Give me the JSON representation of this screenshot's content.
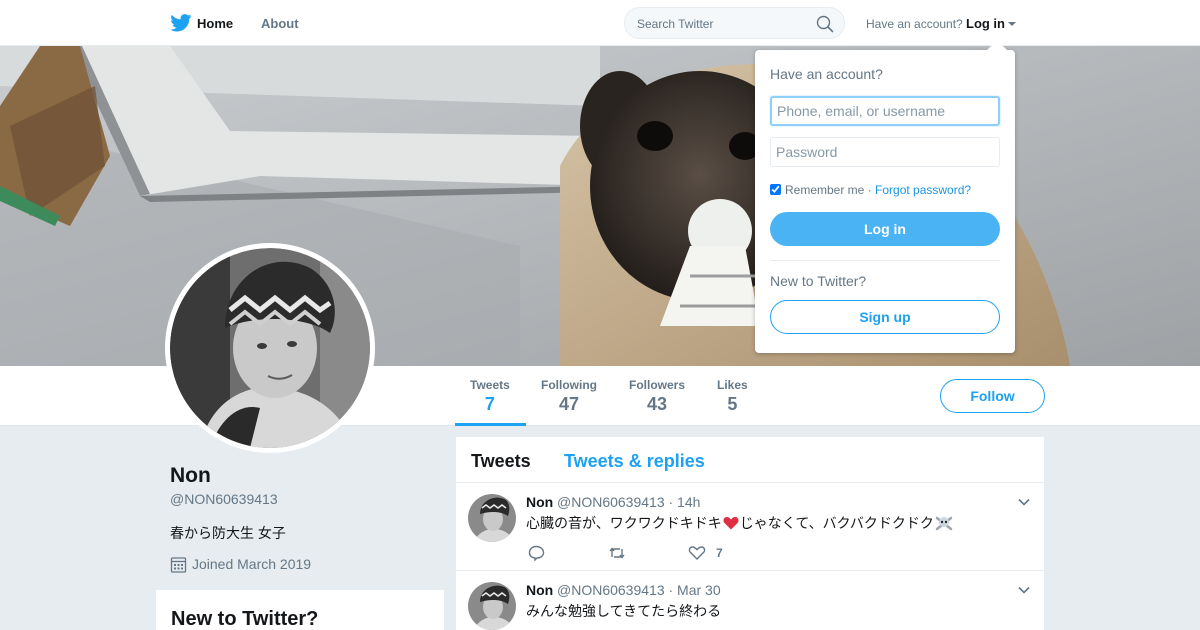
{
  "nav": {
    "home_label": "Home",
    "about_label": "About",
    "search_placeholder": "Search Twitter",
    "have_account": "Have an account?",
    "login_label": "Log in"
  },
  "profile": {
    "name": "Non",
    "handle": "@NON60639413",
    "bio": "春から防大生 女子",
    "joined": "Joined March 2019",
    "follow_label": "Follow"
  },
  "stats": [
    {
      "label": "Tweets",
      "value": "7"
    },
    {
      "label": "Following",
      "value": "47"
    },
    {
      "label": "Followers",
      "value": "43"
    },
    {
      "label": "Likes",
      "value": "5"
    }
  ],
  "timeline": {
    "tabs": [
      "Tweets",
      "Tweets & replies"
    ],
    "tweets": [
      {
        "name": "Non",
        "handle_time": "@NON60639413 · 14h",
        "text": "心臓の音が、ワクワクドキドキ",
        "text_tail": "じゃなくて、バクバクドクドク",
        "likes": "7"
      },
      {
        "name": "Non",
        "handle_time": "@NON60639413 · Mar 30",
        "text": "みんな勉強してきてたら終わる"
      }
    ]
  },
  "sidebar_box": {
    "title": "New to Twitter?"
  },
  "login_dropdown": {
    "title": "Have an account?",
    "username_placeholder": "Phone, email, or username",
    "password_placeholder": "Password",
    "remember": "Remember me",
    "separator": " · ",
    "forgot": "Forgot password?",
    "login_button": "Log in",
    "new_to_twitter": "New to Twitter?",
    "signup_button": "Sign up"
  },
  "colors": {
    "accent": "#1da1f2",
    "login_button_bg": "#4ab3f4",
    "page_bg": "#e6ecf0"
  },
  "icons": [
    "twitter-bird-icon",
    "search-icon",
    "calendar-icon",
    "reply-icon",
    "retweet-icon",
    "heart-icon",
    "chevron-down-icon",
    "red-heart-emoji",
    "skull-crossbones-emoji"
  ]
}
